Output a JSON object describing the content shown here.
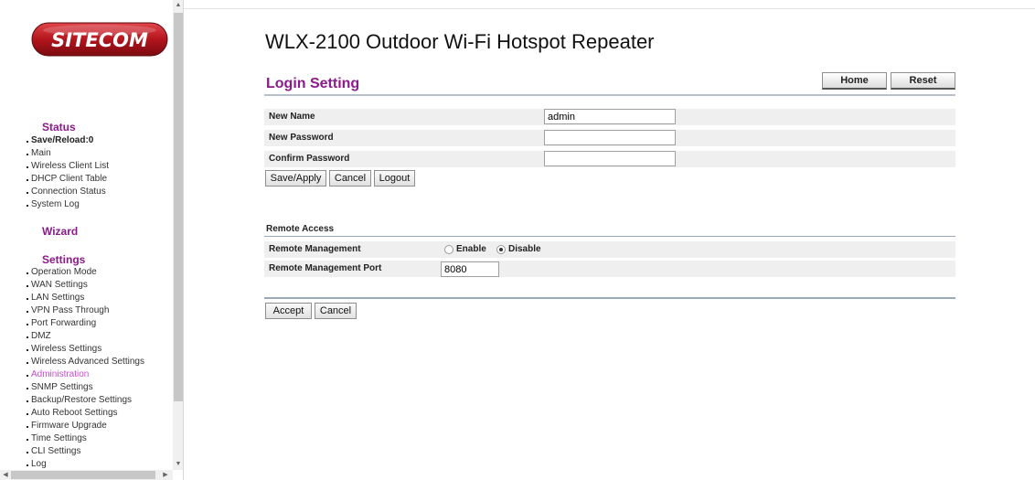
{
  "brand": {
    "logo_text": "SITECOM"
  },
  "sidebar": {
    "status_heading": "Status",
    "status_items": [
      {
        "label": "Save/Reload:0"
      },
      {
        "label": "Main"
      },
      {
        "label": "Wireless Client List"
      },
      {
        "label": "DHCP Client Table"
      },
      {
        "label": "Connection Status"
      },
      {
        "label": "System Log"
      }
    ],
    "wizard_heading": "Wizard",
    "settings_heading": "Settings",
    "settings_items": [
      {
        "label": "Operation Mode"
      },
      {
        "label": "WAN Settings"
      },
      {
        "label": "LAN Settings"
      },
      {
        "label": "VPN Pass Through"
      },
      {
        "label": "Port Forwarding"
      },
      {
        "label": "DMZ"
      },
      {
        "label": "Wireless Settings"
      },
      {
        "label": "Wireless Advanced Settings"
      },
      {
        "label": "Administration"
      },
      {
        "label": "SNMP Settings"
      },
      {
        "label": "Backup/Restore Settings"
      },
      {
        "label": "Auto Reboot Settings"
      },
      {
        "label": "Firmware Upgrade"
      },
      {
        "label": "Time Settings"
      },
      {
        "label": "CLI Settings"
      },
      {
        "label": "Log"
      }
    ],
    "active_item": "Administration",
    "active_color": "#d04ad8",
    "heading_color": "#8b1a8b"
  },
  "main": {
    "device_title": "WLX-2100 Outdoor Wi-Fi Hotspot Repeater",
    "section_title": "Login Setting",
    "home_label": "Home",
    "reset_label": "Reset",
    "login": {
      "new_name_label": "New Name",
      "new_name_value": "admin",
      "new_password_label": "New Password",
      "new_password_value": "",
      "confirm_password_label": "Confirm Password",
      "confirm_password_value": "",
      "save_label": "Save/Apply",
      "cancel_label": "Cancel",
      "logout_label": "Logout"
    },
    "remote": {
      "heading": "Remote Access",
      "mgmt_label": "Remote Management",
      "enable_label": "Enable",
      "disable_label": "Disable",
      "selected": "Disable",
      "port_label": "Remote Management Port",
      "port_value": "8080",
      "accept_label": "Accept",
      "cancel_label": "Cancel"
    }
  }
}
